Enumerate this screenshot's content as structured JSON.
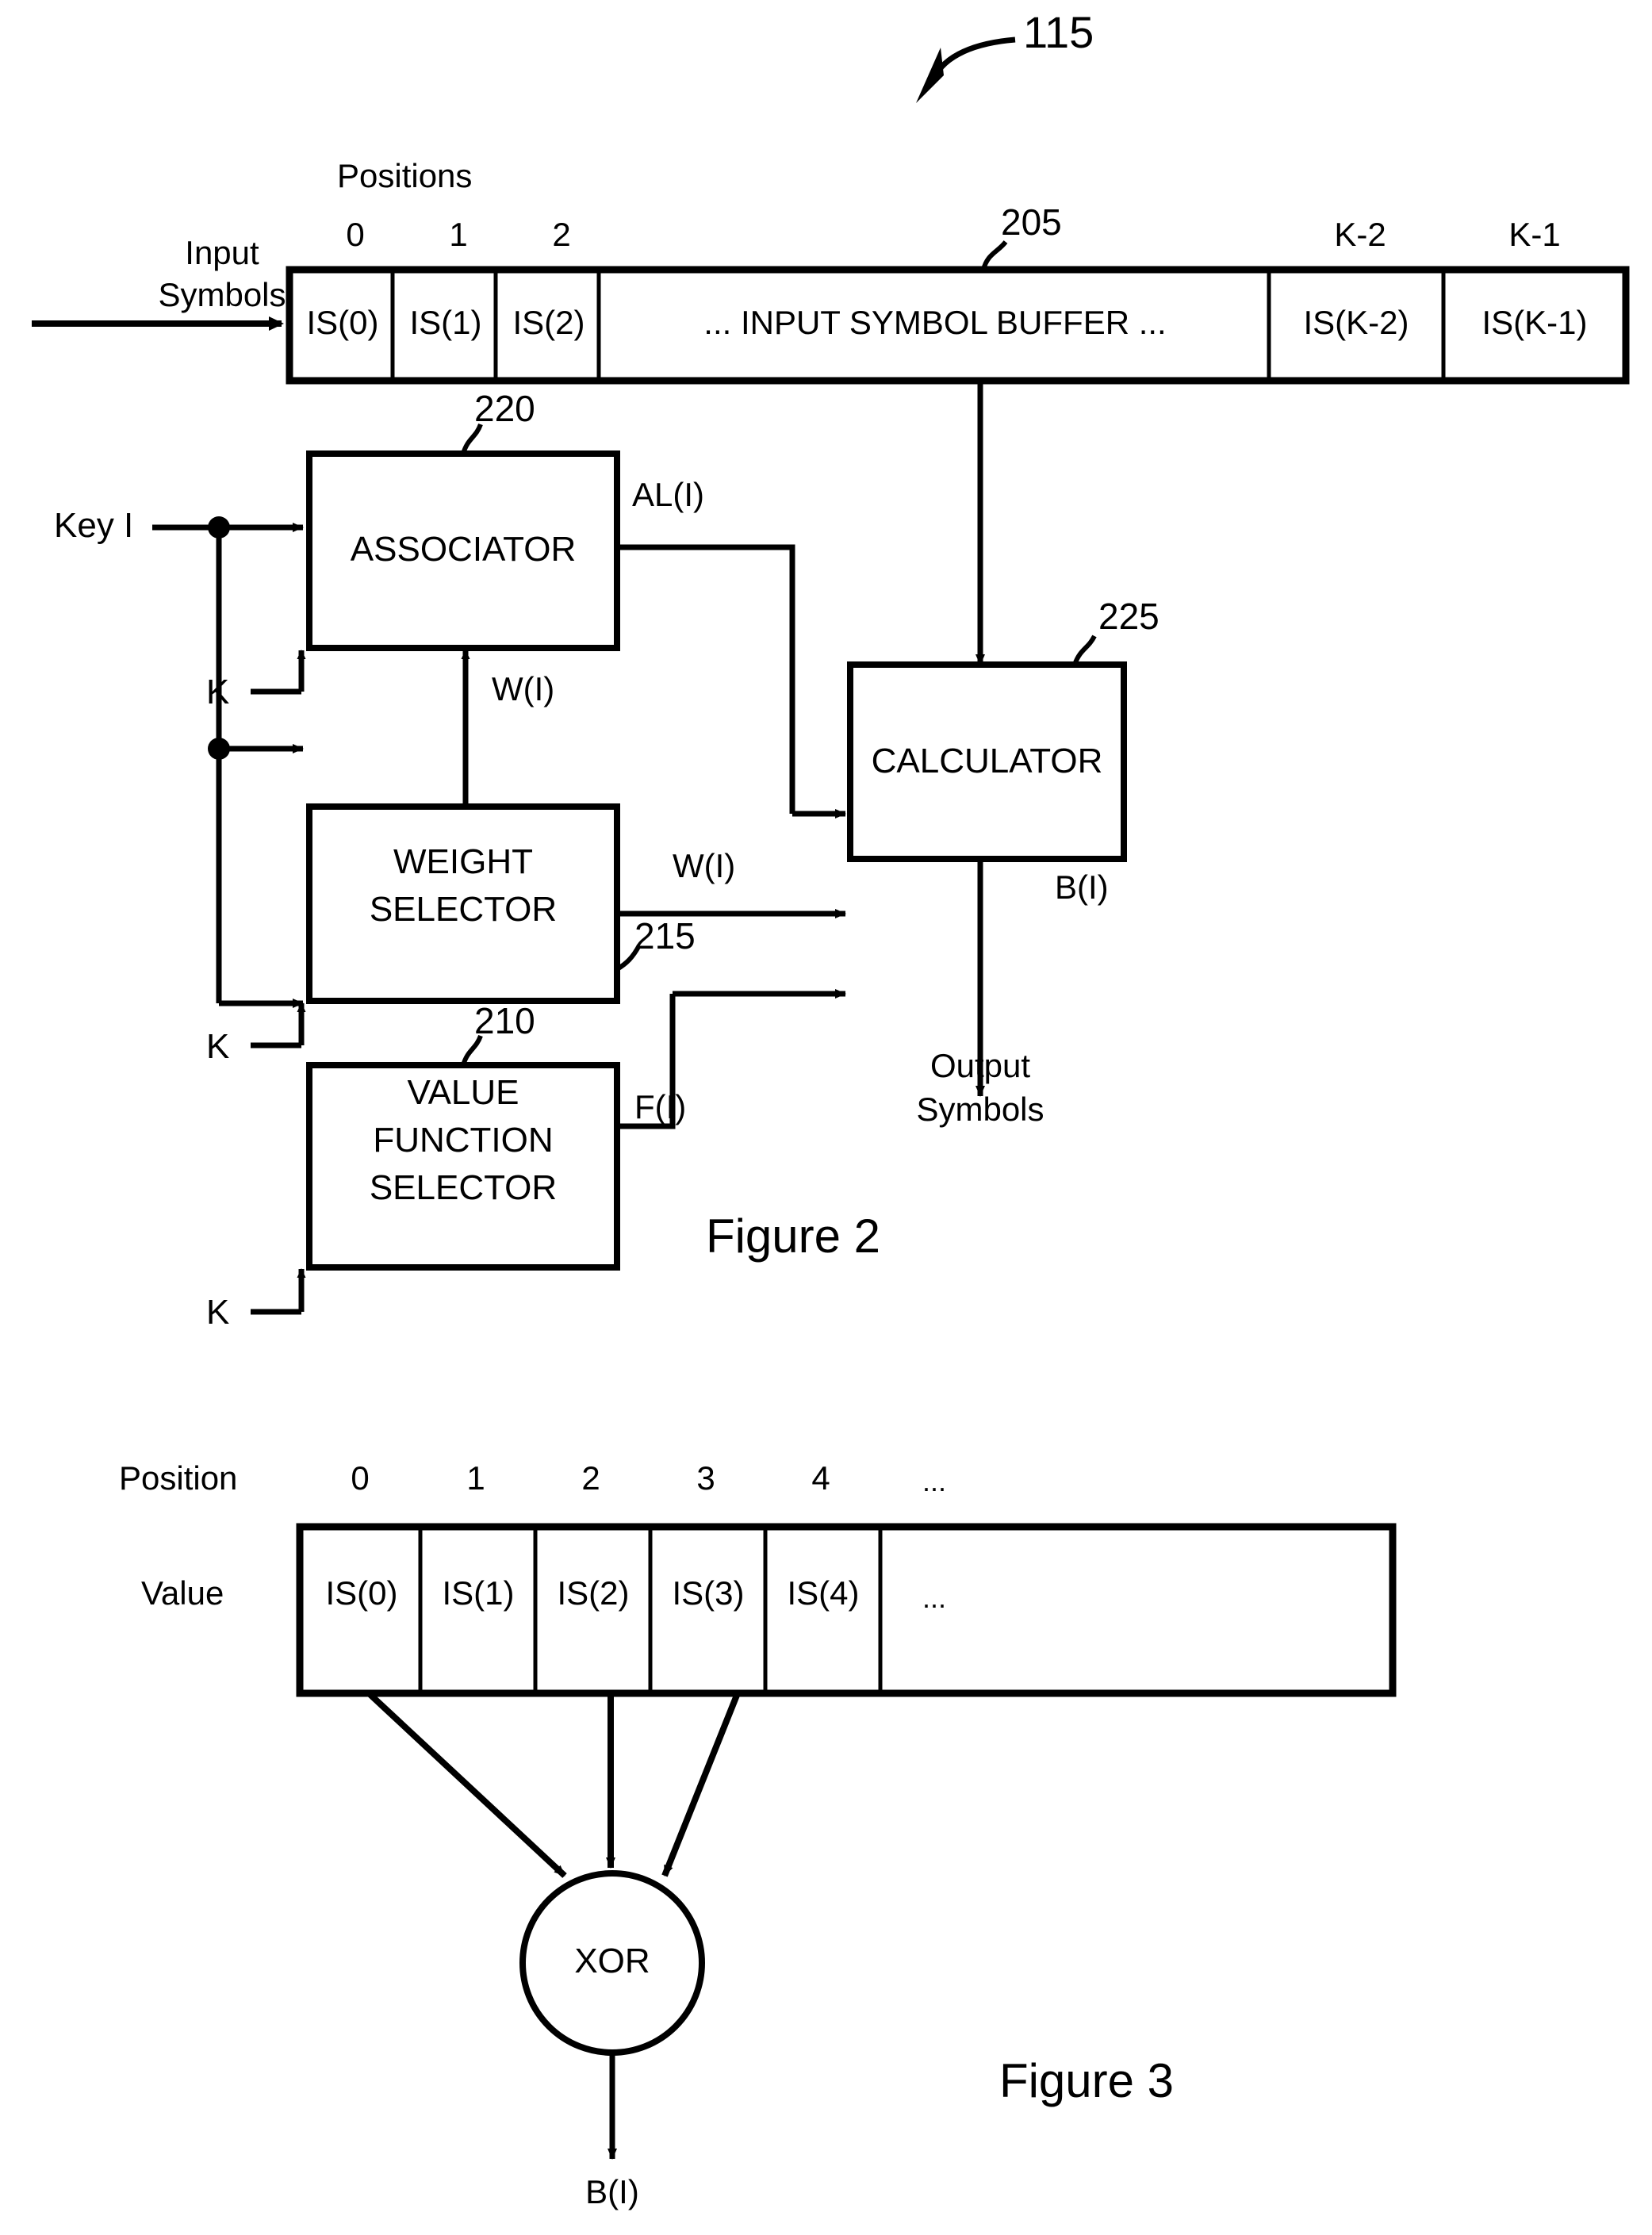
{
  "figure2": {
    "ref_label": "115",
    "caption": "Figure 2",
    "positions_label": "Positions",
    "input_label_line1": "Input",
    "input_label_line2": "Symbols",
    "buffer": {
      "ref": "205",
      "position_headers": [
        "0",
        "1",
        "2",
        "K-2",
        "K-1"
      ],
      "cells": [
        "IS(0)",
        "IS(1)",
        "IS(2)",
        "... INPUT SYMBOL BUFFER ...",
        "IS(K-2)",
        "IS(K-1)"
      ]
    },
    "key_label": "Key I",
    "blocks": [
      {
        "name": "associator",
        "ref": "220",
        "lines": [
          "ASSOCIATOR"
        ],
        "out_label": "AL(I)"
      },
      {
        "name": "weight-selector",
        "ref": "215",
        "lines": [
          "WEIGHT",
          "SELECTOR"
        ],
        "out_label": "W(I)"
      },
      {
        "name": "value-function-selector",
        "ref": "210",
        "lines": [
          "VALUE",
          "FUNCTION",
          "SELECTOR"
        ],
        "out_label": "F(I)"
      },
      {
        "name": "calculator",
        "ref": "225",
        "lines": [
          "CALCULATOR"
        ],
        "out_label": "B(I)"
      }
    ],
    "k_inputs": [
      "K",
      "K",
      "K"
    ],
    "weight_feedback_label": "W(I)",
    "output_label_line1": "Output",
    "output_label_line2": "Symbols"
  },
  "figure3": {
    "caption": "Figure 3",
    "row_header_position": "Position",
    "row_header_value": "Value",
    "position_headers": [
      "0",
      "1",
      "2",
      "3",
      "4",
      "..."
    ],
    "cells": [
      "IS(0)",
      "IS(1)",
      "IS(2)",
      "IS(3)",
      "IS(4)",
      "..."
    ],
    "gate_label": "XOR",
    "output_label": "B(I)"
  },
  "colors": {
    "ink": "#000000",
    "paper": "#ffffff"
  }
}
